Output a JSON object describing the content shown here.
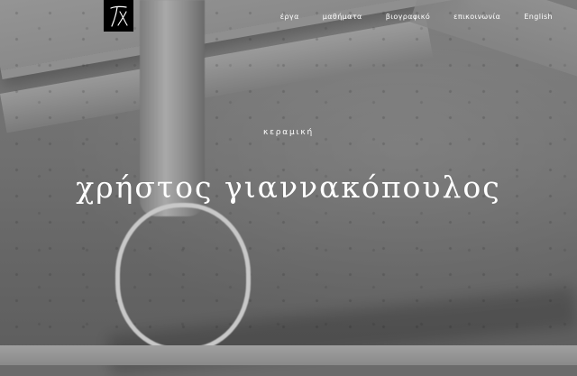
{
  "header": {
    "logo_alt": "ΓΧ monogram",
    "nav": [
      {
        "label": "έργα"
      },
      {
        "label": "μαθήματα"
      },
      {
        "label": "βιογραφικό"
      },
      {
        "label": "επικοινωνία"
      },
      {
        "label": "English"
      }
    ]
  },
  "hero": {
    "subtitle": "κεραμική",
    "title": "χρήστος γιαννακόπουλος"
  }
}
